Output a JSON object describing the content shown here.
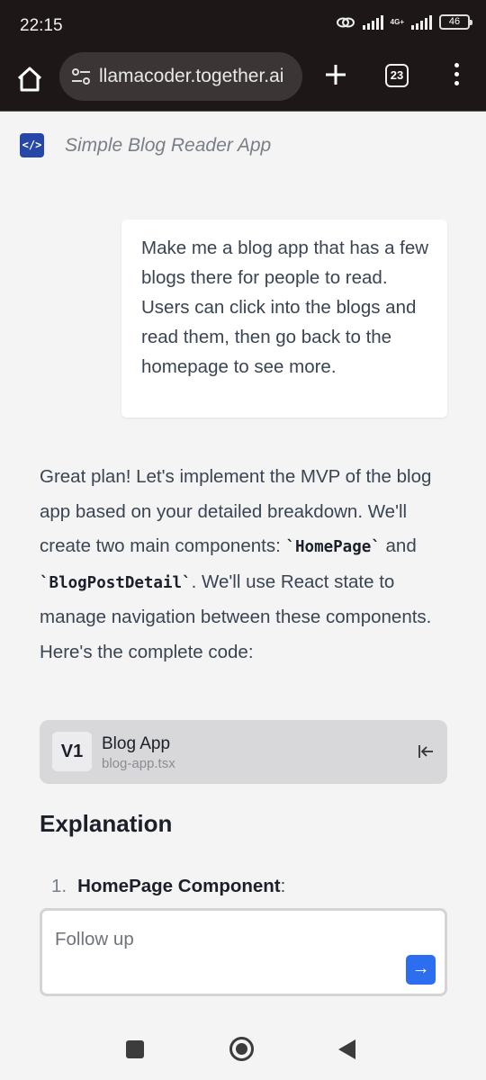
{
  "status": {
    "time": "22:15",
    "network": "4G+",
    "battery": "46"
  },
  "browser": {
    "url": "llamacoder.together.ai",
    "tab_count": "23"
  },
  "app": {
    "title": "Simple Blog Reader App",
    "logo_icon": "code-icon",
    "brand_color": "#2647a8"
  },
  "conversation": {
    "user_message": "Make me a blog app that has a few blogs there for people to read. Users can click into the blogs and read them, then go back to the homepage to see more.",
    "answer_part1": "Great plan! Let's implement the MVP of the blog app based on your detailed breakdown. We'll create two main components: ",
    "code_homepage": "`HomePage`",
    "answer_and": " and ",
    "code_blogpostdetail": "`BlogPostDetail`",
    "answer_part2": ". We'll use React state to manage navigation between these components. Here's the complete code:"
  },
  "artifact": {
    "version": "V1",
    "name": "Blog App",
    "filename": "blog-app.tsx"
  },
  "explanation": {
    "heading": "Explanation",
    "items": [
      {
        "number": "1.",
        "title": "HomePage Component",
        "suffix": ":"
      }
    ]
  },
  "followup": {
    "placeholder": "Follow up",
    "send_icon": "arrow-right-icon",
    "send_color": "#2d6ef0"
  }
}
